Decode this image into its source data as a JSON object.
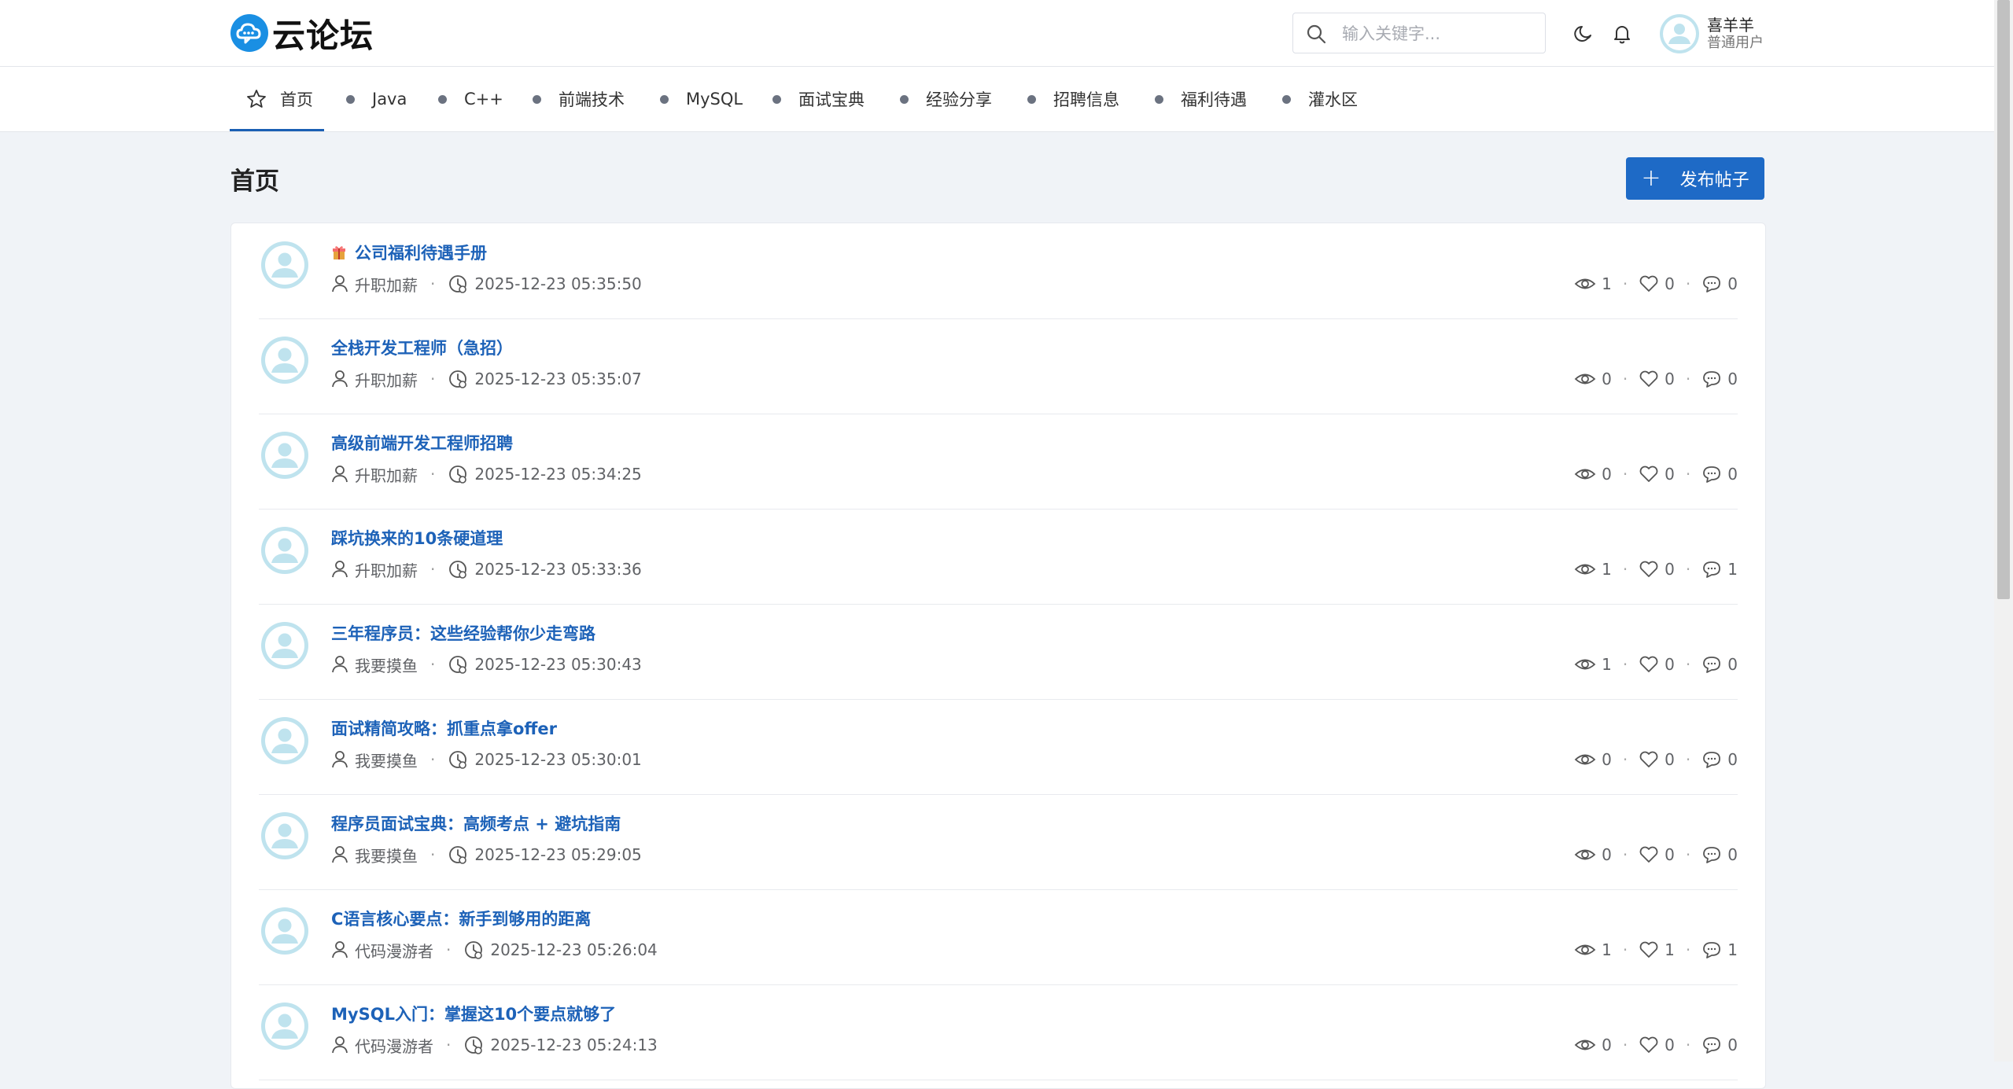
{
  "brand": {
    "name": "云论坛",
    "accent": "#1e6ac6",
    "logo_icon": "cloud-chat-icon"
  },
  "search": {
    "placeholder": "输入关键字...",
    "value": ""
  },
  "header": {
    "theme_icon": "moon-icon",
    "notification_icon": "bell-icon"
  },
  "user": {
    "name": "喜羊羊",
    "role": "普通用户"
  },
  "nav": {
    "active": "首页",
    "items": [
      {
        "label": "首页",
        "icon": "star-icon"
      },
      {
        "label": "Java",
        "icon": "dot"
      },
      {
        "label": "C++",
        "icon": "dot"
      },
      {
        "label": "前端技术",
        "icon": "dot"
      },
      {
        "label": "MySQL",
        "icon": "dot"
      },
      {
        "label": "面试宝典",
        "icon": "dot"
      },
      {
        "label": "经验分享",
        "icon": "dot"
      },
      {
        "label": "招聘信息",
        "icon": "dot"
      },
      {
        "label": "福利待遇",
        "icon": "dot"
      },
      {
        "label": "灌水区",
        "icon": "dot"
      }
    ]
  },
  "page": {
    "title": "首页",
    "publish_label": "发布帖子"
  },
  "posts": [
    {
      "title": "公司福利待遇手册",
      "emoji": "🎁",
      "author": "升职加薪",
      "time": "2025-12-23 05:35:50",
      "views": "1",
      "likes": "0",
      "comments": "0"
    },
    {
      "title": "全栈开发工程师（急招）",
      "author": "升职加薪",
      "time": "2025-12-23 05:35:07",
      "views": "0",
      "likes": "0",
      "comments": "0"
    },
    {
      "title": "高级前端开发工程师招聘",
      "author": "升职加薪",
      "time": "2025-12-23 05:34:25",
      "views": "0",
      "likes": "0",
      "comments": "0"
    },
    {
      "title": "踩坑换来的10条硬道理",
      "author": "升职加薪",
      "time": "2025-12-23 05:33:36",
      "views": "1",
      "likes": "0",
      "comments": "1"
    },
    {
      "title": "三年程序员：这些经验帮你少走弯路",
      "author": "我要摸鱼",
      "time": "2025-12-23 05:30:43",
      "views": "1",
      "likes": "0",
      "comments": "0"
    },
    {
      "title": "面试精简攻略：抓重点拿offer",
      "author": "我要摸鱼",
      "time": "2025-12-23 05:30:01",
      "views": "0",
      "likes": "0",
      "comments": "0"
    },
    {
      "title": "程序员面试宝典：高频考点 + 避坑指南",
      "author": "我要摸鱼",
      "time": "2025-12-23 05:29:05",
      "views": "0",
      "likes": "0",
      "comments": "0"
    },
    {
      "title": "C语言核心要点：新手到够用的距离",
      "author": "代码漫游者",
      "time": "2025-12-23 05:26:04",
      "views": "1",
      "likes": "1",
      "comments": "1"
    },
    {
      "title": "MySQL入门：掌握这10个要点就够了",
      "author": "代码漫游者",
      "time": "2025-12-23 05:24:13",
      "views": "0",
      "likes": "0",
      "comments": "0"
    }
  ]
}
